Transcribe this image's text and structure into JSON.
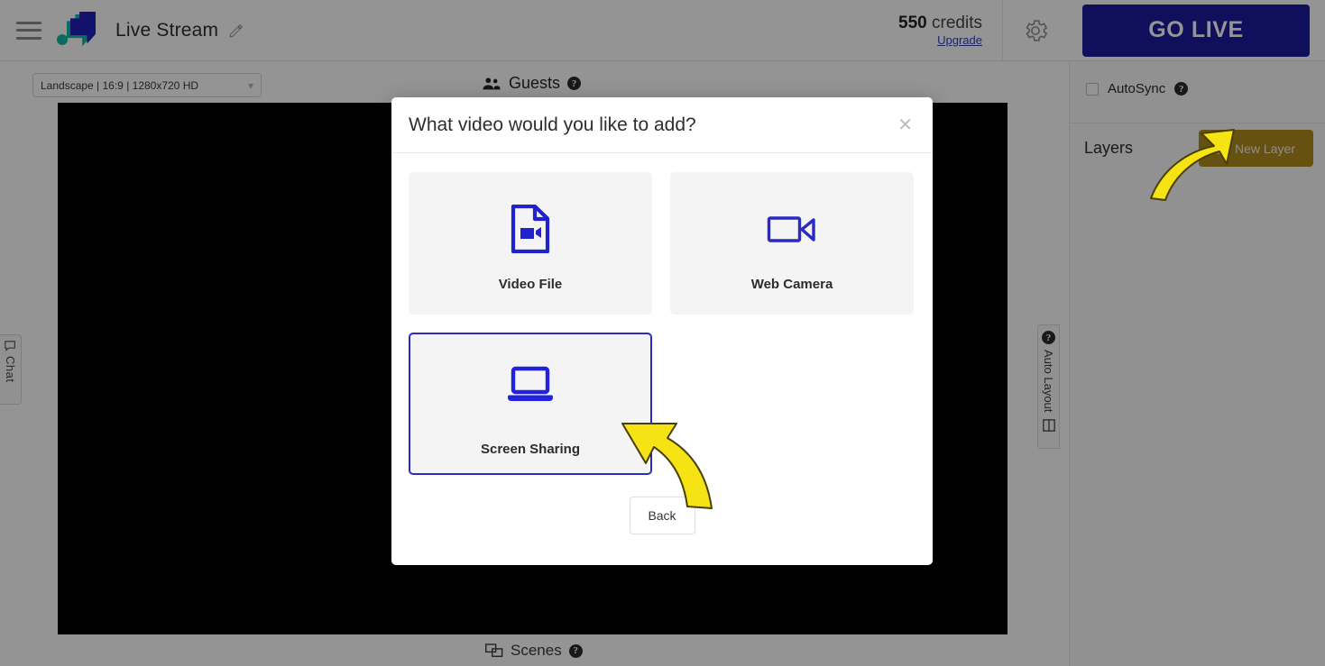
{
  "header": {
    "menu_icon": "hamburger-menu-icon",
    "logo_icon": "app-logo-icon",
    "stream_title": "Live Stream",
    "edit_icon": "pencil-edit-icon",
    "credits_value": "550",
    "credits_word": "credits",
    "upgrade_label": "Upgrade",
    "settings_icon": "gear-icon",
    "go_live_label": "GO LIVE",
    "go_live_color": "#1a1a9e"
  },
  "toolbar": {
    "format_value": "Landscape | 16:9 | 1280x720 HD",
    "format_chevron": "chevron-down-icon",
    "guests_label": "Guests",
    "guests_icon": "people-group-icon",
    "guests_help": "?",
    "scenes_label": "Scenes",
    "scenes_icon": "scenes-windows-icon",
    "scenes_help": "?"
  },
  "left_tab": {
    "label": "Chat",
    "icon": "chat-bubble-icon"
  },
  "right_tab": {
    "label": "Auto Layout",
    "help": "?",
    "icon": "layout-grid-icon"
  },
  "right_panel": {
    "autosync_label": "AutoSync",
    "autosync_help": "?",
    "autosync_checked": false,
    "layers_label": "Layers",
    "new_layer_label": "New Layer",
    "new_layer_icon": "plus-square-icon",
    "new_layer_color": "#b28c1d"
  },
  "modal": {
    "title": "What video would you like to add?",
    "close_icon": "close-icon",
    "options": [
      {
        "label": "Video File",
        "icon": "video-file-icon",
        "selected": false
      },
      {
        "label": "Web Camera",
        "icon": "web-camera-icon",
        "selected": false
      },
      {
        "label": "Screen Sharing",
        "icon": "laptop-screen-share-icon",
        "selected": true
      }
    ],
    "back_label": "Back",
    "accent_color": "#2b2bc4"
  },
  "annotations": {
    "arrow_color": "#f5e316",
    "arrow_to_screen_sharing": "curved-arrow-icon",
    "arrow_to_new_layer": "curved-arrow-icon"
  }
}
